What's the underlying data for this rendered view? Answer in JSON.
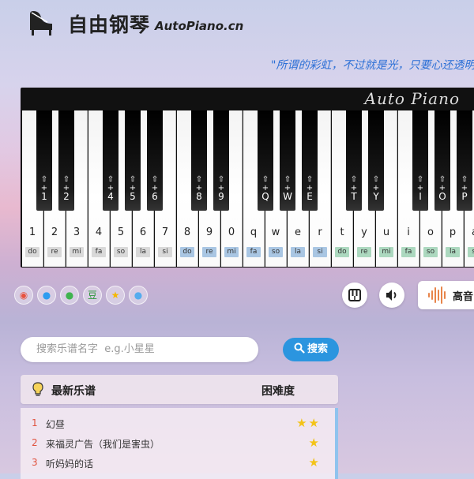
{
  "header": {
    "title": "自由钢琴",
    "domain": "AutoPiano.cn",
    "slogan": "\"所谓的彩虹，不过就是光，只要心还透明"
  },
  "piano": {
    "brand": "Auto Piano",
    "white_keys": [
      {
        "char": "1",
        "solfege": "do",
        "color": "#d9d9d9"
      },
      {
        "char": "2",
        "solfege": "re",
        "color": "#d9d9d9"
      },
      {
        "char": "3",
        "solfege": "mi",
        "color": "#d9d9d9"
      },
      {
        "char": "4",
        "solfege": "fa",
        "color": "#d9d9d9"
      },
      {
        "char": "5",
        "solfege": "so",
        "color": "#d9d9d9"
      },
      {
        "char": "6",
        "solfege": "la",
        "color": "#d9d9d9"
      },
      {
        "char": "7",
        "solfege": "si",
        "color": "#d9d9d9"
      },
      {
        "char": "8",
        "solfege": "do",
        "color": "#a9c6e3"
      },
      {
        "char": "9",
        "solfege": "re",
        "color": "#a9c6e3"
      },
      {
        "char": "0",
        "solfege": "mi",
        "color": "#a9c6e3"
      },
      {
        "char": "q",
        "solfege": "fa",
        "color": "#a9c6e3"
      },
      {
        "char": "w",
        "solfege": "so",
        "color": "#a9c6e3"
      },
      {
        "char": "e",
        "solfege": "la",
        "color": "#a9c6e3"
      },
      {
        "char": "r",
        "solfege": "si",
        "color": "#a9c6e3"
      },
      {
        "char": "t",
        "solfege": "do",
        "color": "#acd8bf"
      },
      {
        "char": "y",
        "solfege": "re",
        "color": "#acd8bf"
      },
      {
        "char": "u",
        "solfege": "mi",
        "color": "#acd8bf"
      },
      {
        "char": "i",
        "solfege": "fa",
        "color": "#acd8bf"
      },
      {
        "char": "o",
        "solfege": "so",
        "color": "#acd8bf"
      },
      {
        "char": "p",
        "solfege": "la",
        "color": "#acd8bf"
      },
      {
        "char": "a",
        "solfege": "si",
        "color": "#acd8bf"
      }
    ],
    "black_keys": [
      {
        "shift": "⇧",
        "plus": "+",
        "key": "1"
      },
      {
        "shift": "⇧",
        "plus": "+",
        "key": "2"
      },
      {
        "shift": "⇧",
        "plus": "+",
        "key": "4"
      },
      {
        "shift": "⇧",
        "plus": "+",
        "key": "5"
      },
      {
        "shift": "⇧",
        "plus": "+",
        "key": "6"
      },
      {
        "shift": "⇧",
        "plus": "+",
        "key": "8"
      },
      {
        "shift": "⇧",
        "plus": "+",
        "key": "9"
      },
      {
        "shift": "⇧",
        "plus": "+",
        "key": "Q"
      },
      {
        "shift": "⇧",
        "plus": "+",
        "key": "W"
      },
      {
        "shift": "⇧",
        "plus": "+",
        "key": "E"
      },
      {
        "shift": "⇧",
        "plus": "+",
        "key": "T"
      },
      {
        "shift": "⇧",
        "plus": "+",
        "key": "Y"
      },
      {
        "shift": "⇧",
        "plus": "+",
        "key": "I"
      },
      {
        "shift": "⇧",
        "plus": "+",
        "key": "O"
      },
      {
        "shift": "⇧",
        "plus": "+",
        "key": "P"
      }
    ]
  },
  "socials": [
    {
      "name": "weibo-icon",
      "glyph": "◉",
      "color": "#e8523f"
    },
    {
      "name": "qq-icon",
      "glyph": "●",
      "color": "#2d9cf0"
    },
    {
      "name": "wechat-icon",
      "glyph": "●",
      "color": "#3fb34f"
    },
    {
      "name": "douban-icon",
      "glyph": "豆",
      "color": "#2e963d"
    },
    {
      "name": "qzone-icon",
      "glyph": "★",
      "color": "#f5b800"
    },
    {
      "name": "twitter-icon",
      "glyph": "●",
      "color": "#55acee"
    }
  ],
  "controls": {
    "pitch_label": "高音"
  },
  "search": {
    "placeholder": "搜索乐谱名字  e.g.小星星",
    "button_label": "搜索"
  },
  "scores_panel": {
    "title": "最新乐谱",
    "difficulty_header": "困难度",
    "rows": [
      {
        "num": "1",
        "name": "幻昼",
        "stars": "★★"
      },
      {
        "num": "2",
        "name": "来福灵广告（我们是害虫）",
        "stars": "★"
      },
      {
        "num": "3",
        "name": "听妈妈的话",
        "stars": "★"
      }
    ]
  }
}
